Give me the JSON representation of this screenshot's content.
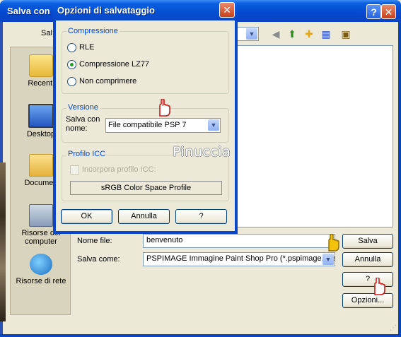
{
  "save_dialog": {
    "title": "Salva con",
    "save_in_label": "Sal",
    "places": [
      {
        "label": "Recenti",
        "icon": "recent-folder-icon"
      },
      {
        "label": "Desktop",
        "icon": "desktop-icon"
      },
      {
        "label": "Documen",
        "icon": "documents-icon"
      },
      {
        "label": "Risorse del computer",
        "icon": "my-computer-icon"
      },
      {
        "label": "Risorse di rete",
        "icon": "network-places-icon"
      }
    ],
    "filename_label": "Nome file:",
    "filename_value": "benvenuto",
    "savetype_label": "Salva come:",
    "savetype_value": "PSPIMAGE Immagine Paint Shop Pro (*.pspimage,*.ps",
    "buttons": {
      "save": "Salva",
      "cancel": "Annulla",
      "help": "?",
      "options": "Opzioni..."
    }
  },
  "options_dialog": {
    "title": "Opzioni di salvataggio",
    "compression": {
      "group_label": "Compressione",
      "options": [
        "RLE",
        "Compressione LZ77",
        "Non comprimere"
      ],
      "selected": "Compressione LZ77"
    },
    "version": {
      "group_label": "Versione",
      "save_with_label": "Salva con nome:",
      "selected": "File compatibile PSP 7"
    },
    "icc": {
      "group_label": "Profilo ICC",
      "embed_label": "Incorpora profilo ICC:",
      "embed_checked": false,
      "profile_button": "sRGB Color Space Profile"
    },
    "buttons": {
      "ok": "OK",
      "cancel": "Annulla",
      "help": "?"
    }
  },
  "watermark": "Pinuccia",
  "colors": {
    "titlebar": "#0a5fe0",
    "dialog_bg": "#ece9d8",
    "group_label": "#0046d5",
    "hand_red": "#d01818",
    "hand_yellow": "#f3c20c"
  }
}
